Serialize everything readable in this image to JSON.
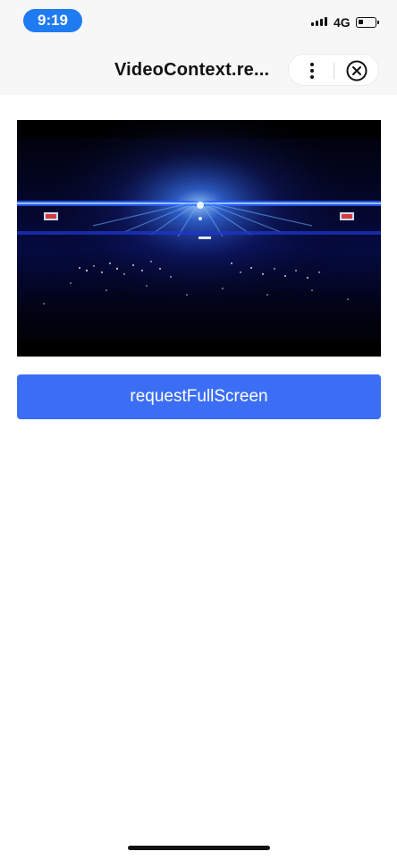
{
  "status_bar": {
    "time": "9:19",
    "network": "4G",
    "battery_level": 0.25,
    "signal_bars": 4
  },
  "nav": {
    "title": "VideoContext.re...",
    "more_icon": "more-vertical-icon",
    "close_icon": "close-circle-icon"
  },
  "video": {
    "content": "concert-stage-blue-lights"
  },
  "actions": {
    "request_fullscreen_label": "requestFullScreen"
  },
  "colors": {
    "time_pill": "#1f7bf2",
    "primary_button": "#3b6ef5",
    "nav_background": "#f7f7f7"
  }
}
